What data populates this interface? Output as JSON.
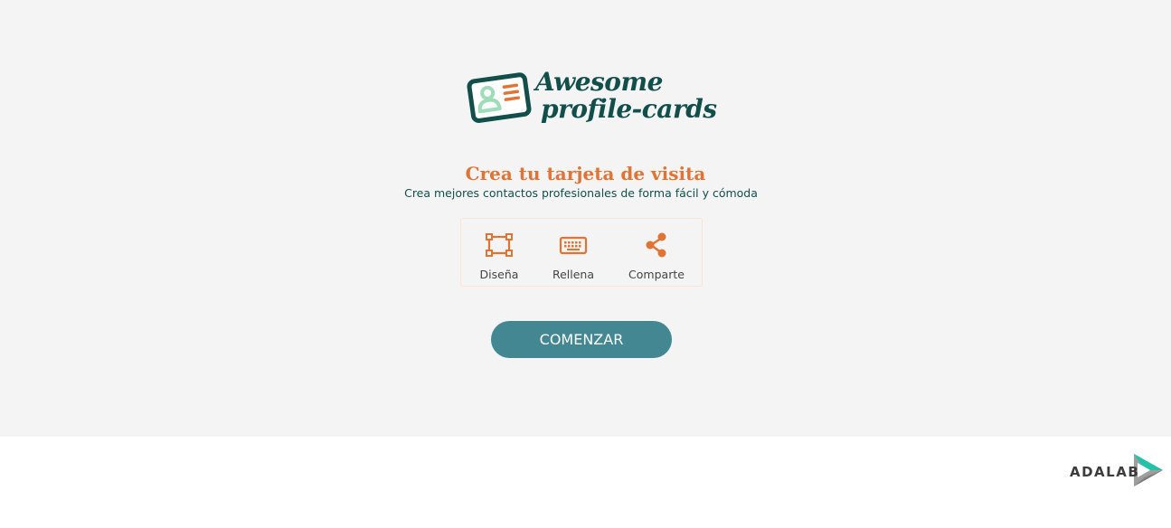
{
  "logo": {
    "line1": "Awesome",
    "line2": "profile-cards",
    "icon": "profile-card-icon",
    "color": "#124f4b",
    "accent": "#e17334",
    "person_color": "#9fdcb8"
  },
  "hero": {
    "title": "Crea tu tarjeta de visita",
    "subtitle": "Crea mejores contactos profesionales de forma fácil y cómoda",
    "background": "#f4f4f4"
  },
  "steps": [
    {
      "icon": "design-frame-icon",
      "label": "Diseña"
    },
    {
      "icon": "keyboard-icon",
      "label": "Rellena"
    },
    {
      "icon": "share-icon",
      "label": "Comparte"
    }
  ],
  "cta": {
    "label": "COMENZAR",
    "color": "#438792"
  },
  "footer": {
    "brand": "ADALAB",
    "brand_icon": "adalab-play-icon",
    "accent": "#20c3aa"
  }
}
